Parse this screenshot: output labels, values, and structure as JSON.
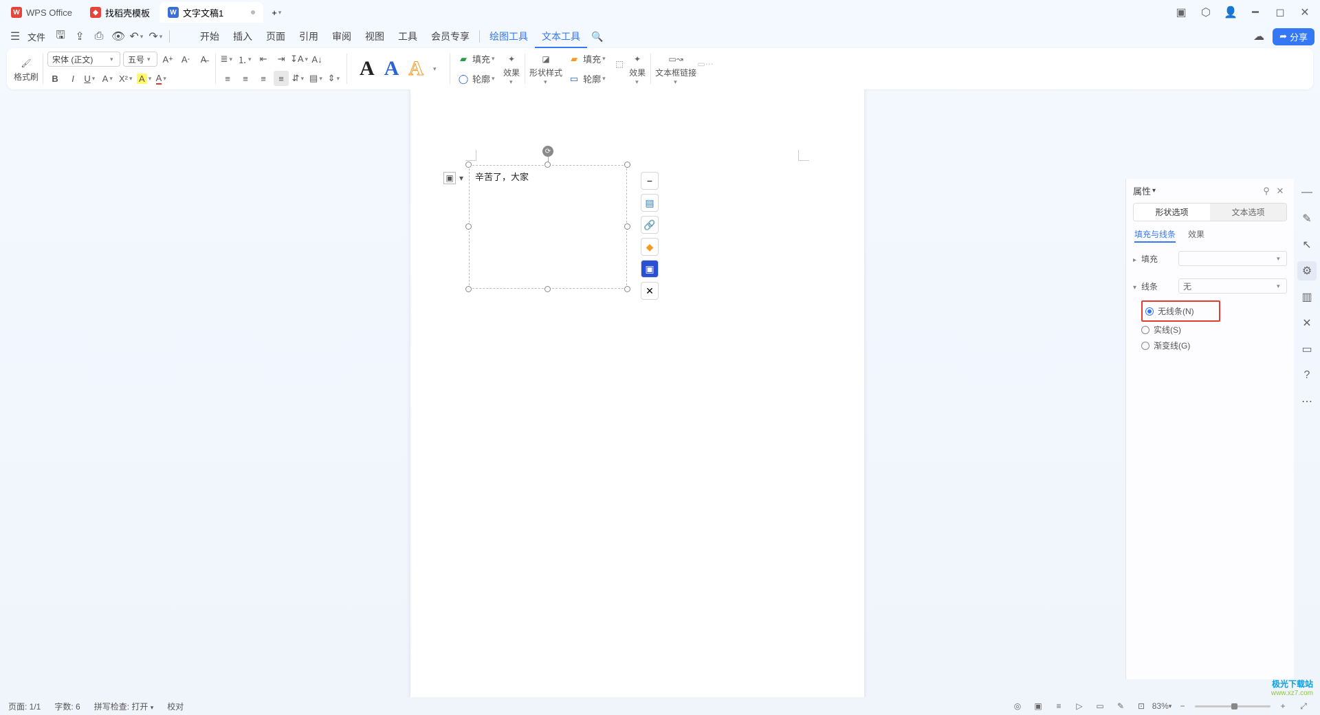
{
  "titlebar": {
    "app_tab": "WPS Office",
    "tab2": "找稻壳模板",
    "tab3": "文字文稿1",
    "add": "+"
  },
  "menubar": {
    "file": "文件",
    "tabs": {
      "start": "开始",
      "insert": "插入",
      "page": "页面",
      "ref": "引用",
      "review": "审阅",
      "view": "视图",
      "tools": "工具",
      "member": "会员专享",
      "drawtool": "绘图工具",
      "texttool": "文本工具"
    },
    "share": "分享"
  },
  "ribbon": {
    "format_painter": "格式刷",
    "font_name": "宋体 (正文)",
    "font_size": "五号",
    "fill": "填充",
    "outline": "轮廓",
    "effect": "效果",
    "shape_style": "形状样式",
    "textbox_link": "文本框链接"
  },
  "document": {
    "textbox_content": "辛苦了，大家"
  },
  "float_tools": {
    "t1": "−",
    "t2": "wrap",
    "t3": "link",
    "t4": "fill",
    "t5": "crop",
    "t6": "tool"
  },
  "properties": {
    "title": "属性",
    "tab_shape": "形状选项",
    "tab_text": "文本选项",
    "sub_fill_line": "填充与线条",
    "sub_effect": "效果",
    "fill_label": "填充",
    "line_label": "线条",
    "line_value": "无",
    "radio_none": "无线条(N)",
    "radio_solid": "实线(S)",
    "radio_gradient": "渐变线(G)"
  },
  "status": {
    "page": "页面: 1/1",
    "words": "字数: 6",
    "spell": "拼写检查: 打开",
    "proof": "校对",
    "zoom": "83%"
  },
  "watermark": {
    "a": "极光下载站",
    "b": "www.xz7.com"
  }
}
